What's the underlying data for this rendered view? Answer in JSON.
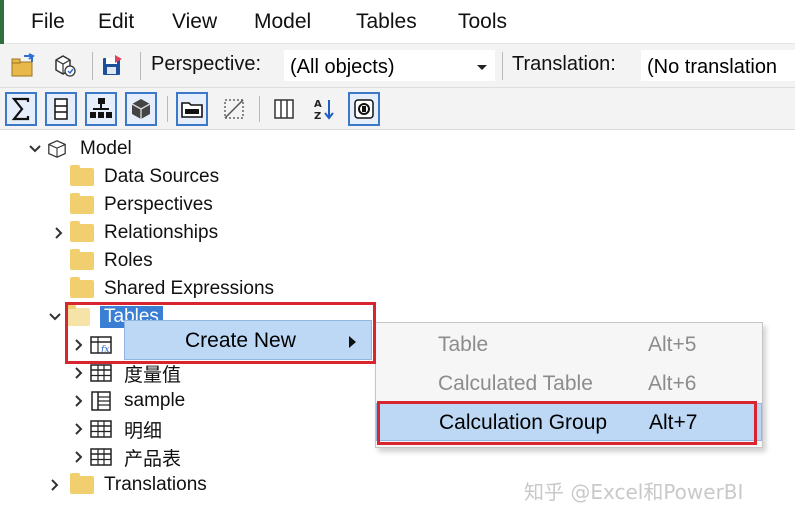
{
  "menu": {
    "items": [
      {
        "label": "File"
      },
      {
        "label": "Edit"
      },
      {
        "label": "View"
      },
      {
        "label": "Model"
      },
      {
        "label": "Tables"
      },
      {
        "label": "Tools"
      }
    ]
  },
  "toolbar": {
    "perspective_label": "Perspective:",
    "perspective_value": "(All objects)",
    "translation_label": "Translation:",
    "translation_value": "(No translation"
  },
  "tree": {
    "root": "Model",
    "data_sources": "Data Sources",
    "perspectives": "Perspectives",
    "relationships": "Relationships",
    "roles": "Roles",
    "shared_expressions": "Shared Expressions",
    "tables": "Tables",
    "table_items": [
      {
        "label": "度量值"
      },
      {
        "label": "sample"
      },
      {
        "label": "明细"
      },
      {
        "label": "产品表"
      }
    ],
    "translations": "Translations"
  },
  "context_menu": {
    "create_new": "Create New"
  },
  "submenu": {
    "items": [
      {
        "label": "Table",
        "shortcut": "Alt+5",
        "enabled": false
      },
      {
        "label": "Calculated Table",
        "shortcut": "Alt+6",
        "enabled": false
      },
      {
        "label": "Calculation Group",
        "shortcut": "Alt+7",
        "enabled": true
      }
    ]
  },
  "watermark": "知乎 @Excel和PowerBI",
  "colors": {
    "highlight": "#bcd8f5",
    "selection": "#3a7fd4",
    "annotation_red": "#d7262f",
    "folder": "#f2cf6e"
  }
}
